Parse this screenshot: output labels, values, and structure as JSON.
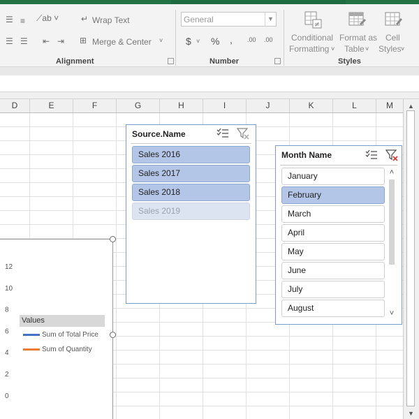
{
  "ribbon": {
    "alignment": {
      "label": "Alignment",
      "wrap_text": "Wrap Text",
      "merge_center": "Merge & Center"
    },
    "number": {
      "label": "Number",
      "format_value": "General",
      "currency_symbol": "$",
      "percent_symbol": "%",
      "comma_symbol": ",",
      "increase_decimal": ".00",
      "decrease_decimal": ".00"
    },
    "styles": {
      "label": "Styles",
      "conditional_line1": "Conditional",
      "conditional_line2": "Formatting",
      "format_as_table_line1": "Format as",
      "format_as_table_line2": "Table",
      "cell_styles_line1": "Cell",
      "cell_styles_line2": "Styles"
    }
  },
  "columns": [
    "D",
    "E",
    "F",
    "G",
    "H",
    "I",
    "J",
    "K",
    "L",
    "M"
  ],
  "slicers": {
    "source": {
      "title": "Source.Name",
      "items": [
        {
          "label": "Sales 2016",
          "state": "selected"
        },
        {
          "label": "Sales 2017",
          "state": "selected"
        },
        {
          "label": "Sales 2018",
          "state": "selected"
        },
        {
          "label": "Sales 2019",
          "state": "no-data"
        }
      ]
    },
    "month": {
      "title": "Month Name",
      "items": [
        {
          "label": "January",
          "state": "unselected"
        },
        {
          "label": "February",
          "state": "selected"
        },
        {
          "label": "March",
          "state": "unselected"
        },
        {
          "label": "April",
          "state": "unselected"
        },
        {
          "label": "May",
          "state": "unselected"
        },
        {
          "label": "June",
          "state": "unselected"
        },
        {
          "label": "July",
          "state": "unselected"
        },
        {
          "label": "August",
          "state": "unselected"
        }
      ]
    }
  },
  "chart_data": {
    "type": "line",
    "y_ticks": [
      "12",
      "10",
      "8",
      "6",
      "4",
      "2",
      "0"
    ],
    "legend_title": "Values",
    "series": [
      {
        "name": "Sum of Total Price",
        "color": "#4472c4"
      },
      {
        "name": "Sum of Quantity",
        "color": "#ed7d31"
      }
    ]
  },
  "colors": {
    "excel_green": "#217346",
    "slicer_selected": "#b4c6e7",
    "slicer_border": "#7d9cc7"
  }
}
